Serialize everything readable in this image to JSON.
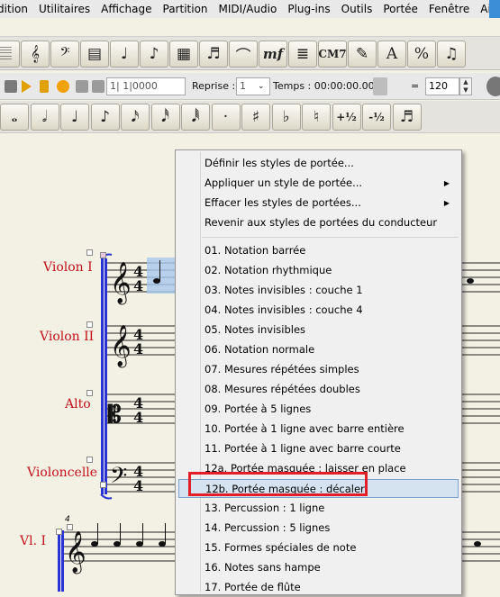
{
  "menubar": {
    "items": [
      "dition",
      "Utilitaires",
      "Affichage",
      "Partition",
      "MIDI/Audio",
      "Plug-ins",
      "Outils",
      "Portée",
      "Fenêtre",
      "Aide"
    ]
  },
  "toolbar1": {
    "buttons": [
      "𝄚",
      "𝄞",
      "𝄢",
      "▤",
      "♩",
      "♪",
      "▦",
      "♬",
      "⌒",
      "mf",
      "≣",
      "CM7",
      "✎",
      "A",
      "%",
      "♫"
    ]
  },
  "toolbar2": {
    "position": "1| 1|0000",
    "reprise_label": "Reprise :",
    "reprise_value": "1",
    "tempo_label": "Temps : 00:00:00.000",
    "equals": "=",
    "tempo_value": "120"
  },
  "toolbar3": {
    "buttons": [
      "𝅝",
      "𝅗𝅥",
      "♩",
      "♪",
      "𝅘𝅥𝅯",
      "𝅘𝅥𝅰",
      "𝅘𝅥𝅱",
      "·",
      "♯",
      "♭",
      "♮",
      "+½",
      "-½",
      "♬"
    ]
  },
  "score": {
    "instruments": [
      "Violon I",
      "Violon II",
      "Alto",
      "Violoncelle",
      "Vl. I"
    ],
    "time_signature": "4/4",
    "measure_number": "4"
  },
  "context_menu": {
    "top_items": [
      {
        "label": "Définir les styles de portée...",
        "submenu": false
      },
      {
        "label": "Appliquer un style de portée...",
        "submenu": true
      },
      {
        "label": "Effacer les styles de portées...",
        "submenu": true
      },
      {
        "label": "Revenir aux styles de portées du conducteur",
        "submenu": false
      }
    ],
    "styles": [
      "01.  Notation barrée",
      "02.  Notation rhythmique",
      "03.  Notes invisibles : couche 1",
      "04.  Notes invisibles : couche 4",
      "05.  Notes invisibles",
      "06.  Notation normale",
      "07.  Mesures répétées simples",
      "08.  Mesures répétées doubles",
      "09.  Portée à 5 lignes",
      "10.  Portée à 1 ligne avec barre entière",
      "11.  Portée à 1 ligne avec barre courte",
      "12a.  Portée masquée : laisser en place",
      "12b.  Portée masquée : décaler",
      "13.  Percussion : 1 ligne",
      "14.  Percussion : 5 lignes",
      "15.  Formes spéciales de note",
      "16.  Notes sans hampe",
      "17.  Portée de flûte"
    ],
    "highlighted_index": 12
  },
  "colors": {
    "instrument_red": "#c3101a",
    "highlight_bg": "#d5e3f1",
    "annotation_red": "#e21e26",
    "bracket_blue": "#2a33d6",
    "paper": "#f3f1e4"
  }
}
